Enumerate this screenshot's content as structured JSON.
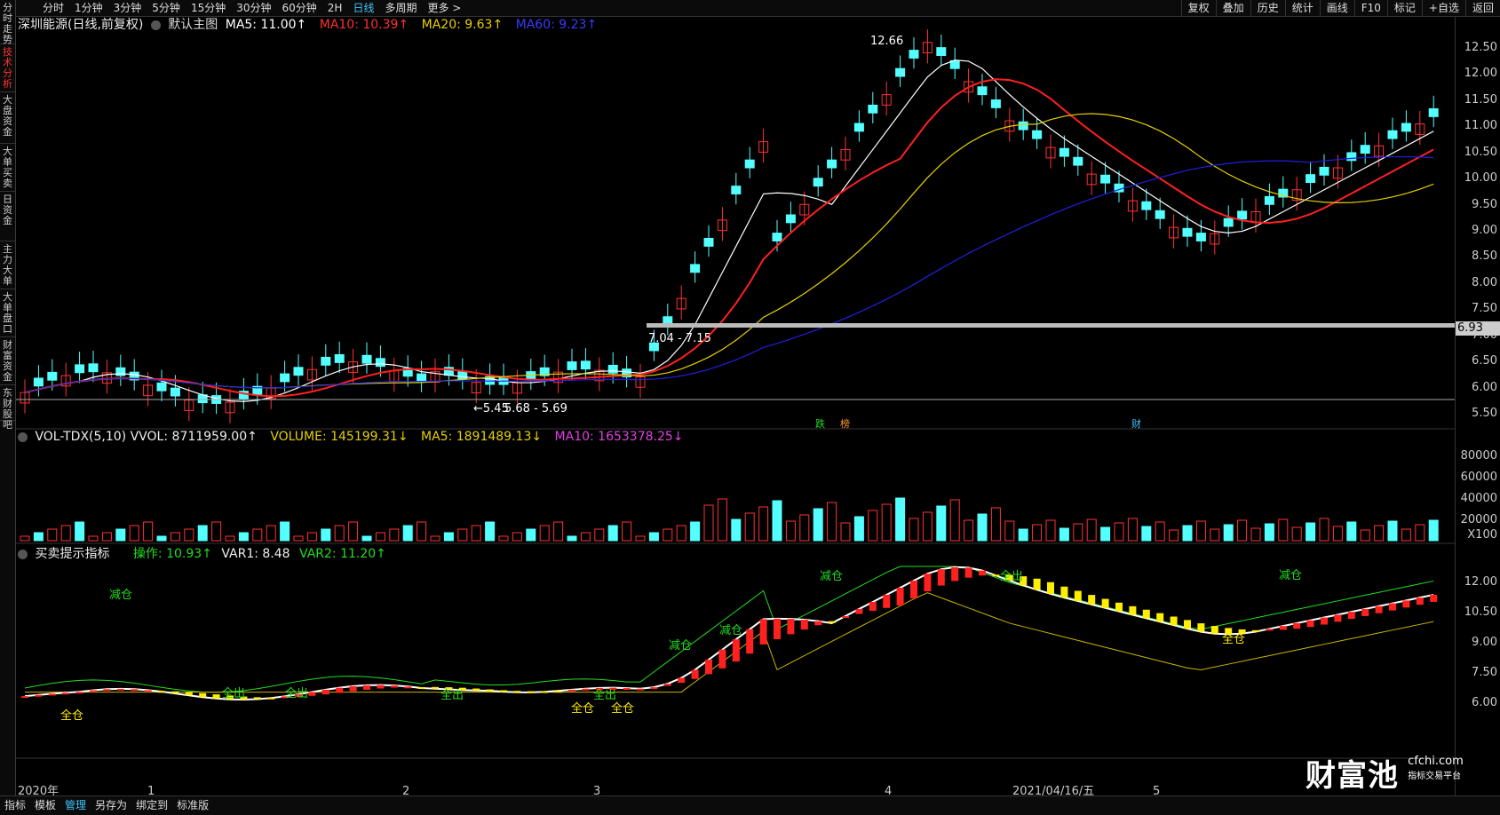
{
  "sidebar": {
    "tabs": [
      {
        "label": "分时走势",
        "active": false
      },
      {
        "label": "技术分析",
        "active": true
      },
      {
        "label": "大盘资金",
        "active": false
      },
      {
        "label": "大单买卖",
        "active": false
      },
      {
        "label": "日资金",
        "active": false
      },
      {
        "label": "主力大单",
        "active": false
      },
      {
        "label": "大单盘口",
        "active": false
      },
      {
        "label": "财富资金",
        "active": false
      },
      {
        "label": "东财股吧",
        "active": false
      }
    ]
  },
  "topbar": {
    "periods": [
      "分时",
      "1分钟",
      "3分钟",
      "5分钟",
      "15分钟",
      "30分钟",
      "60分钟",
      "2H",
      "日线",
      "多周期",
      "更多 >"
    ],
    "active_period": "日线",
    "tools": [
      "复权",
      "叠加",
      "历史",
      "统计",
      "画线",
      "F10",
      "标记",
      "+自选",
      "返回"
    ]
  },
  "main_legend": {
    "title": "深圳能源(日线,前复权)",
    "template": "默认主图",
    "ma5": "MA5: 11.00↑",
    "ma10": "MA10: 10.39↑",
    "ma20": "MA20: 9.63↑",
    "ma60": "MA60: 9.23↑"
  },
  "price_annotations": {
    "high": "12.66",
    "low": "5.45",
    "low_range": "5.68 - 5.69",
    "mid_range": "7.04 - 7.15",
    "current_line": "6.93",
    "markers": [
      "跌",
      "榜",
      "财"
    ]
  },
  "vol_legend": {
    "name": "VOL-TDX(5,10)",
    "vvol": "VVOL: 8711959.00↑",
    "volume": "VOLUME: 145199.31↓",
    "ma5": "MA5: 1891489.13↓",
    "ma10": "MA10: 1653378.25↓"
  },
  "ind_legend": {
    "name": "买卖提示指标",
    "op": "操作: 10.93↑",
    "var1": "VAR1: 8.48",
    "var2": "VAR2: 11.20↑"
  },
  "ind_labels": {
    "reduce": "减仓",
    "all_out": "全出",
    "all_in": "全仓"
  },
  "yaxis": {
    "price": [
      "12.50",
      "12.00",
      "11.50",
      "11.00",
      "10.50",
      "10.00",
      "9.50",
      "9.00",
      "8.50",
      "8.00",
      "7.50",
      "7.00",
      "6.50",
      "6.00",
      "5.50"
    ],
    "volume": [
      "80000",
      "60000",
      "40000",
      "20000",
      "X100"
    ],
    "indicator": [
      "12.00",
      "10.50",
      "9.00",
      "7.50",
      "6.00"
    ]
  },
  "xaxis": {
    "labels": [
      "2020年",
      "1",
      "2",
      "3",
      "4",
      "2021/04/16/五",
      "5"
    ],
    "period_label": "日线"
  },
  "bottombar": {
    "tabs": [
      "指标",
      "模板",
      "管理",
      "另存为",
      "绑定到",
      "标准版"
    ],
    "active": "管理"
  },
  "watermark": {
    "brand": "财富池",
    "site": "cfchi.com",
    "tag": "指标交易平台"
  },
  "colors": {
    "up": "#ff3232",
    "down": "#54ffff",
    "ma5": "#ffffff",
    "ma10": "#ff2020",
    "ma20": "#e6d000",
    "ma60": "#2020e0",
    "accent": "#3fc6ff"
  }
}
